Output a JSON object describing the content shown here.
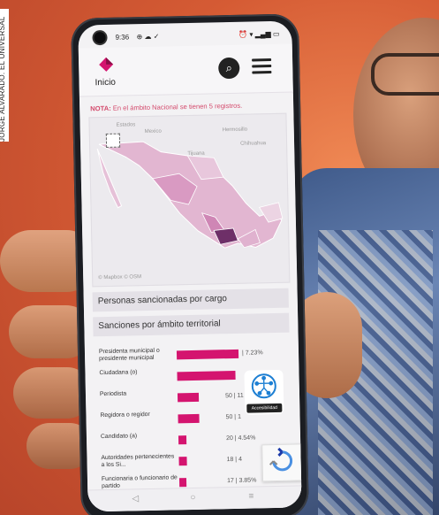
{
  "credit": "JORGE ALVARADO. EL UNIVERSAL",
  "status": {
    "time": "9:36",
    "left_icons": "⊕ ☁ ✓",
    "right_icons": "⏰ ▾ ▂▄▆ ▭"
  },
  "header": {
    "logo_label": "Inicio",
    "brand_color": "#d4146f"
  },
  "note": {
    "prefix": "NOTA:",
    "text": "En el ámbito Nacional se tienen 5 registros."
  },
  "map": {
    "labels": [
      "Estados",
      "Mexico",
      "Tijuana",
      "Hermosillo",
      "Chihuahua"
    ],
    "credit": "© Mapbox  © OSM"
  },
  "sections": {
    "by_position": "Personas sancionadas por cargo",
    "by_territory": "Sanciones por ámbito territorial"
  },
  "chart_data": {
    "type": "bar",
    "title": "Sanciones por ámbito territorial",
    "categories": [
      "Presidenta municipal o presidente municipal",
      "Ciudadana (o)",
      "Periodista",
      "Regidora o regidor",
      "Candidato (a)",
      "Autoridades pertenecientes a los Si...",
      "Funcionaria o funcionario de partido"
    ],
    "values": [
      32,
      30,
      11,
      11,
      4,
      4,
      3.85
    ],
    "value_labels": [
      "| 7.23%",
      "",
      "50 | 11",
      "50 | 1",
      "20 | 4.54%",
      "18 | 4",
      "17 | 3.85%"
    ],
    "color": "#d4146f"
  },
  "accessibility": {
    "label": "Accesibilidad"
  },
  "navbar": {
    "back": "◁",
    "home": "○",
    "recent": "≡"
  }
}
